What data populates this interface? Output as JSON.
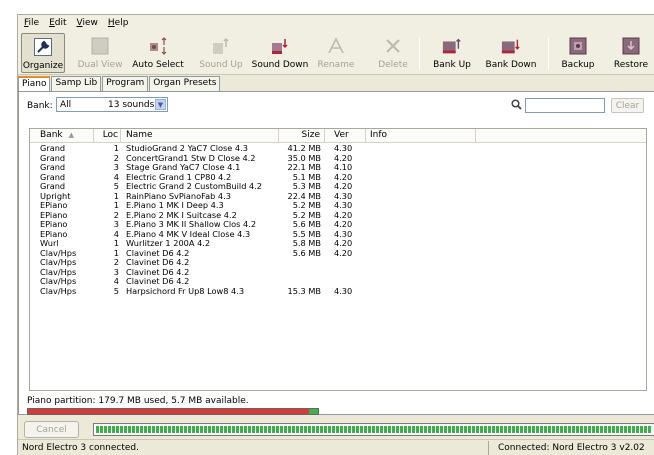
{
  "menu": [
    {
      "key": "F",
      "rest": "ile"
    },
    {
      "key": "E",
      "rest": "dit"
    },
    {
      "key": "V",
      "rest": "iew"
    },
    {
      "key": "H",
      "rest": "elp"
    }
  ],
  "toolbar": {
    "organize": "Organize",
    "dual_view": "Dual View",
    "auto_select": "Auto Select",
    "sound_up": "Sound Up",
    "sound_down": "Sound Down",
    "rename": "Rename",
    "delete": "Delete",
    "bank_up": "Bank Up",
    "bank_down": "Bank Down",
    "backup": "Backup",
    "restore": "Restore"
  },
  "tabs": [
    "Piano",
    "Samp Lib",
    "Program",
    "Organ Presets"
  ],
  "filter": {
    "bank_label": "Bank:",
    "bank_value": "All",
    "count": "13 sounds",
    "search_value": "",
    "clear_label": "Clear"
  },
  "table": {
    "headers": [
      "Bank",
      "Loc",
      "Name",
      "Size",
      "Ver",
      "Info"
    ],
    "rows": [
      [
        "Grand",
        "1",
        "StudioGrand 2 YaC7  Close 4.3",
        "41.2 MB",
        "4.30"
      ],
      [
        "Grand",
        "2",
        "ConcertGrand1 Stw D  Close 4.2",
        "35.0 MB",
        "4.20"
      ],
      [
        "Grand",
        "3",
        "Stage Grand YaC7  Close 4.1",
        "22.1 MB",
        "4.10"
      ],
      [
        "Grand",
        "4",
        "Electric Grand 1 CP80 4.2",
        "5.1 MB",
        "4.20"
      ],
      [
        "Grand",
        "5",
        "Electric Grand 2 CustomBuild 4.2",
        "5.3 MB",
        "4.20"
      ],
      [
        "Upright",
        "1",
        "RainPiano SvPianoFab  4.3",
        "22.4 MB",
        "4.30"
      ],
      [
        "EPiano",
        "1",
        "E.Piano 1 MK I Deep 4.3",
        "5.2 MB",
        "4.30"
      ],
      [
        "EPiano",
        "2",
        "E.Piano 2 MK I Suitcase 4.2",
        "5.2 MB",
        "4.20"
      ],
      [
        "EPiano",
        "3",
        "E.Piano 3 MK II Shallow Clos 4.2",
        "5.6 MB",
        "4.20"
      ],
      [
        "EPiano",
        "4",
        "E.Piano 4 MK V Ideal Close 4.3",
        "5.5 MB",
        "4.30"
      ],
      [
        "Wurl",
        "1",
        "Wurlitzer 1 200A 4.2",
        "5.8 MB",
        "4.20"
      ],
      [
        "Clav/Hps",
        "1",
        "Clavinet D6  4.2",
        "5.6 MB",
        "4.20"
      ],
      [
        "Clav/Hps",
        "2",
        "Clavinet D6  4.2",
        "",
        ""
      ],
      [
        "Clav/Hps",
        "3",
        "Clavinet D6  4.2",
        "",
        ""
      ],
      [
        "Clav/Hps",
        "4",
        "Clavinet D6  4.2",
        "",
        ""
      ],
      [
        "Clav/Hps",
        "5",
        "Harpsichord Fr Up8 Low8 4.3",
        "15.3 MB",
        "4.30"
      ]
    ]
  },
  "partition": {
    "label": "Piano partition: 179.7 MB used, 5.7 MB available.",
    "used_fraction": 0.969,
    "avail_fraction": 0.031
  },
  "cancel_label": "Cancel",
  "progress_fraction": 1.0,
  "status": {
    "left": "Nord Electro 3 connected.",
    "right": "Connected: Nord Electro 3 v2.02"
  },
  "colors": {
    "bar_used": "#d63b3b",
    "bar_avail": "#3fb14a",
    "tab_accent": "#e68b2c"
  }
}
